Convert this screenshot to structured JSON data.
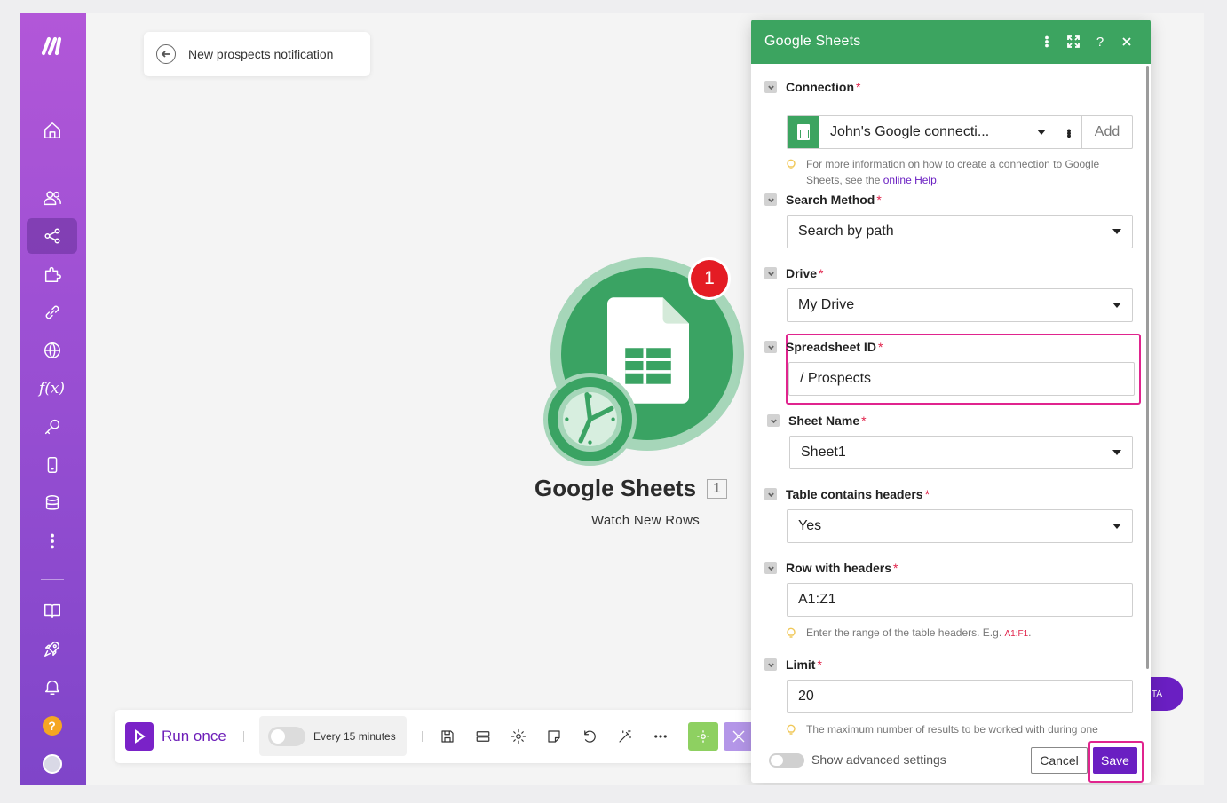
{
  "scenario": {
    "title": "New prospects notification"
  },
  "sidebar": {
    "items": [
      {
        "name": "home",
        "icon": "home-icon"
      },
      {
        "name": "team",
        "icon": "users-icon"
      },
      {
        "name": "scenarios",
        "icon": "share-icon",
        "active": true
      },
      {
        "name": "templates",
        "icon": "puzzle-icon"
      },
      {
        "name": "connections",
        "icon": "link-icon"
      },
      {
        "name": "webhooks",
        "icon": "globe-icon"
      },
      {
        "name": "functions",
        "icon": "function-icon"
      },
      {
        "name": "keys",
        "icon": "key-icon"
      },
      {
        "name": "devices",
        "icon": "mobile-icon"
      },
      {
        "name": "data-stores",
        "icon": "database-icon"
      },
      {
        "name": "more",
        "icon": "more-vertical-icon"
      },
      {
        "name": "docs",
        "icon": "book-icon"
      },
      {
        "name": "launch",
        "icon": "rocket-icon"
      },
      {
        "name": "notifications",
        "icon": "bell-icon"
      },
      {
        "name": "help",
        "icon": "help-icon"
      },
      {
        "name": "profile",
        "icon": "avatar"
      }
    ]
  },
  "module": {
    "name": "Google Sheets",
    "id": "1",
    "subtitle": "Watch New Rows",
    "badge": "1"
  },
  "toolbar": {
    "run_once": "Run once",
    "schedule": "Every 15 minutes"
  },
  "float_button": {
    "label": "TA"
  },
  "panel": {
    "title": "Google Sheets",
    "connection": {
      "label": "Connection",
      "value": "John's Google connecti...",
      "add": "Add",
      "hint_prefix": "For more information on how to create a connection to Google Sheets, see the ",
      "hint_link": "online Help",
      "hint_suffix": "."
    },
    "search_method": {
      "label": "Search Method",
      "value": "Search by path"
    },
    "drive": {
      "label": "Drive",
      "value": "My Drive"
    },
    "spreadsheet_id": {
      "label": "Spreadsheet ID",
      "value": "/ Prospects"
    },
    "sheet_name": {
      "label": "Sheet Name",
      "value": "Sheet1"
    },
    "table_headers": {
      "label": "Table contains headers",
      "value": "Yes"
    },
    "row_headers": {
      "label": "Row with headers",
      "value": "A1:Z1",
      "hint": "Enter the range of the table headers. E.g. ",
      "hint_code": "A1:F1",
      "hint_suffix": "."
    },
    "limit": {
      "label": "Limit",
      "value": "20",
      "hint": "The maximum number of results to be worked with during one"
    },
    "footer": {
      "advanced": "Show advanced settings",
      "cancel": "Cancel",
      "save": "Save"
    }
  },
  "colors": {
    "sidebar_top": "#b257d8",
    "sidebar_bottom": "#7f45c9",
    "sheets_green": "#3ca460",
    "accent_purple": "#6a1fc2",
    "highlight_pink": "#e0248e",
    "badge_red": "#e41c24"
  }
}
